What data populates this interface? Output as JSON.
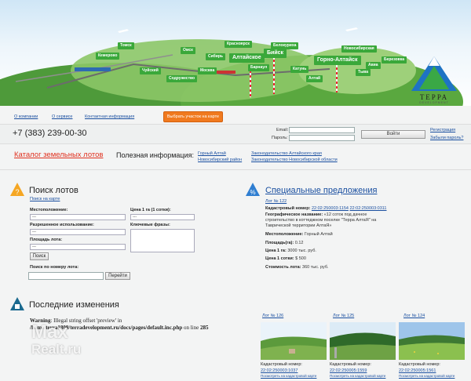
{
  "banner": {
    "signs": [
      "Алтайское",
      "Бийск",
      "Горно-Алтайск",
      "Новосибирская",
      "Барнаул",
      "Белокуриха",
      "Алтай",
      "Сибирь",
      "Катунь",
      "Авиа",
      "Тыва",
      "Кемерово",
      "Томск",
      "Омск",
      "Красноярск",
      "Содружество",
      "Чуйский",
      "Москва",
      "Березовка"
    ],
    "logo_text": "ТЕРРА",
    "logo_sub": "DEVELOPMENT"
  },
  "nav": {
    "about": "О компании",
    "services": "О сервисе",
    "contacts": "Контактная информация",
    "pick_button": "Выбрать участок на карте"
  },
  "header": {
    "phone": "+7 (383) 239-00-30",
    "email_label": "Email:",
    "password_label": "Пароль:",
    "login_button": "Войти",
    "register": "Регистрация",
    "forgot": "Забыли пароль?"
  },
  "catalog": {
    "link": "Каталог земельных лотов",
    "useful_label": "Полезная информация:",
    "links": [
      "Горный Алтай",
      "Новосибирский район",
      "Законодательство Алтайского края",
      "Законодательство Новосибирской области"
    ]
  },
  "search": {
    "title": "Поиск лотов",
    "map_link": "Поиск на карте",
    "location_label": "Местоположение:",
    "usage_label": "Разрешенное использование:",
    "area_label": "Площадь лота:",
    "price_label": "Цена 1 га (1 сотки):",
    "keywords_label": "Ключевые фразы:",
    "select_value": "---",
    "search_button": "Поиск",
    "number_label": "Поиск по номеру лота:",
    "go_button": "Перейти"
  },
  "special": {
    "title": "Специальные предложения",
    "lot_link": "Лот № 122",
    "cad_label": "Кадастровый номер:",
    "cad_values": [
      "22:02:250003:1154",
      "22:02:250003:0311"
    ],
    "geo_label": "Географическое название:",
    "geo_value": "«12 соток под дачное строительство в коттеджном поселке \"Терра АлтаЯ\" на Тавричеcкой территории АлтаЯ»",
    "loc_label": "Местоположение:",
    "loc_value": "Горный Алтай",
    "area_label": "Площадь(га):",
    "area_value": "0.12",
    "price_ga_label": "Цена 1 га:",
    "price_ga_value": "3000 тыс. руб.",
    "price_sotka_label": "Цена 1 сотки:",
    "price_sotka_value": "$ 500",
    "cost_label": "Стоимость лота:",
    "cost_value": "360 тыс. руб."
  },
  "recent": {
    "title": "Последние изменения",
    "warning_bold": "Warning",
    "warning_text": ": Illegal string offset 'preview' in",
    "warning_path": "/home/terra1809/terradevelopment.ru/docs/pages/default.inc.php",
    "warning_line_prefix": "on line",
    "warning_line": "285",
    "cards": [
      {
        "lot": "Лот № 126",
        "cad_label": "Кадастровый номер:",
        "cad": "22:02:250003:1037",
        "link": "Посмотреть на кадастровой карте"
      },
      {
        "lot": "Лот № 125",
        "cad_label": "Кадастровый номер:",
        "cad": "22:02:250005:1559",
        "link": "Посмотреть на кадастровой карте"
      },
      {
        "lot": "Лот № 124",
        "cad_label": "Кадастровый номер:",
        "cad": "22:02:250005:1561",
        "link": "Посмотреть на кадастровой карте"
      }
    ]
  },
  "watermark": {
    "max": "Max",
    "realt": "Realt.ru"
  }
}
